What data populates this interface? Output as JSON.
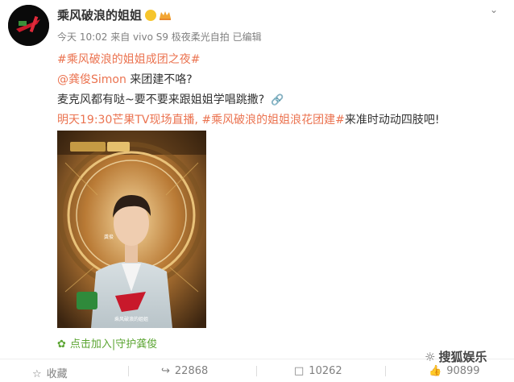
{
  "header": {
    "name": "乘风破浪的姐姐",
    "meta": "今天 10:02 来自 vivo S9 极夜柔光自拍  已编辑"
  },
  "post": {
    "line1": "#乘风破浪的姐姐成团之夜#",
    "mention": "@龚俊Simon",
    "line2_rest": " 来团建不咯?",
    "line3": "麦克风都有哒~要不要来跟姐姐学唱跳撒?",
    "line4_a": "明天19:30芒果TV现场直播,",
    "line4_tag": "#乘风破浪的姐姐浪花团建#",
    "line4_b": "来准时动动四肢吧!"
  },
  "poster": {
    "name_label": "龚俊"
  },
  "guard_link": "点击加入|守护龚俊",
  "actions": {
    "collect": "收藏",
    "repost": "22868",
    "comment": "10262",
    "like": "90899"
  },
  "watermark": "搜狐娱乐",
  "colors": {
    "accent": "#eb7350",
    "green": "#5ba532",
    "meta": "#808080"
  }
}
